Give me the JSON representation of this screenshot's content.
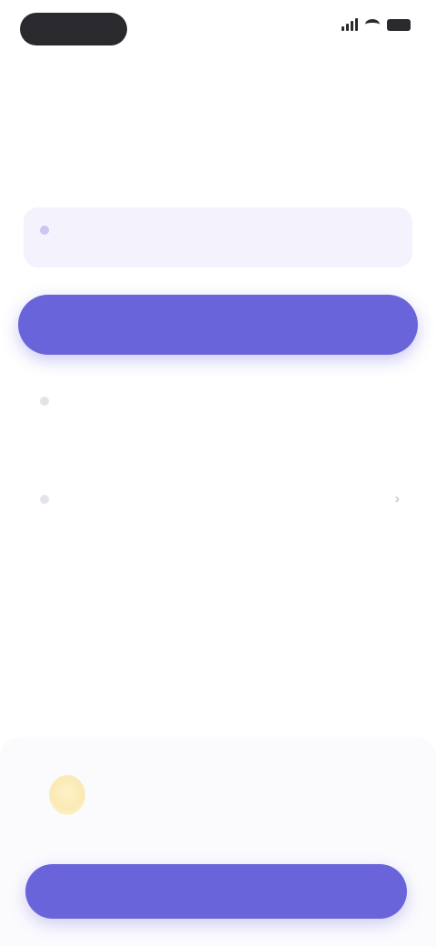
{
  "status_bar": {
    "time": "",
    "icons": [
      "signal-icon",
      "wifi-icon",
      "battery-icon"
    ]
  },
  "header": {
    "top_link": "",
    "title": ""
  },
  "info_card": {
    "text": ""
  },
  "primary_button": {
    "label": ""
  },
  "hints": [
    {
      "text": ""
    },
    {
      "text": ""
    }
  ],
  "bottom": {
    "notice_text": "",
    "continue_label": ""
  },
  "colors": {
    "accent": "#6a64da",
    "card_background": "#f3f2fd",
    "link": "#a8a6ef",
    "notice_icon": "#fbe9b4"
  }
}
